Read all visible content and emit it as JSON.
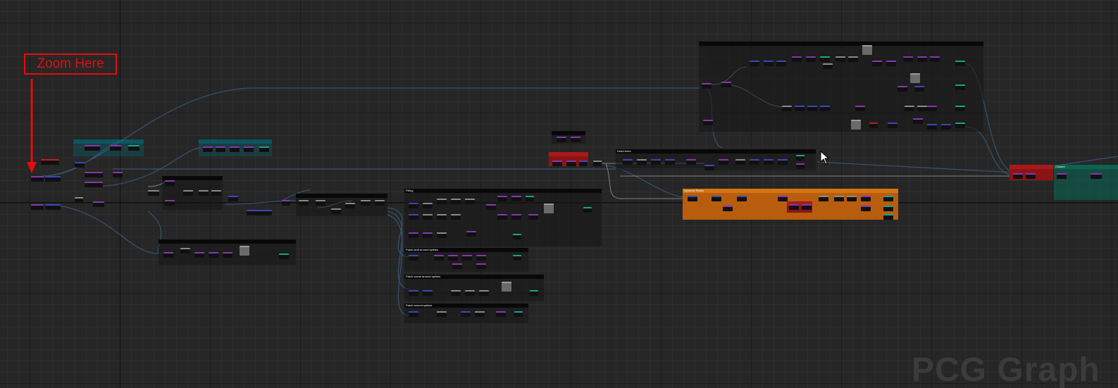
{
  "window": {
    "title": "PCG Graph",
    "watermark": "PCG Graph"
  },
  "annotation": {
    "text": "Zoom Here",
    "color": "#e40d0d"
  },
  "comments": {
    "c1": "",
    "c2": "",
    "c3": "",
    "c4": "",
    "c5": "",
    "c6": "",
    "c7": "Filling",
    "c8": "Patch land around splines",
    "c9": "Patch scene around splines",
    "c10": "Patch around splines",
    "c11": "Dead trees",
    "c12": "Dynamic Rocks",
    "c13": "",
    "c14": "",
    "c15": "",
    "c16": "Closure"
  },
  "colors": {
    "canvas": "#262626",
    "grid_major": "#1c1c1c",
    "grid_minor": "#2d2d2d",
    "wire": "#3a5a7e",
    "wire_light": "#9a9a9a",
    "node_purple": "#8a36b0",
    "node_blue": "#3e46b8",
    "node_teal": "#1aa38a",
    "comment_orange": "#b85d0e",
    "comment_red": "#8c1414"
  },
  "icons": {
    "cursor": "mouse-pointer-icon",
    "arrow": "down-arrow-icon"
  }
}
